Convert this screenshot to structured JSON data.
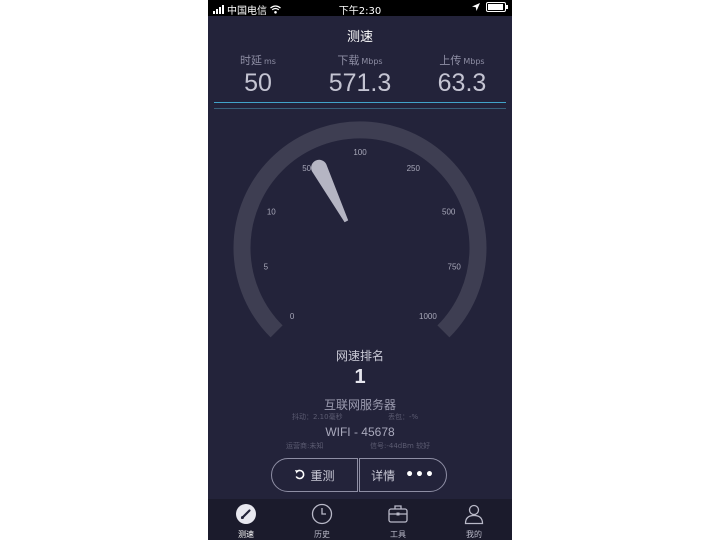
{
  "status_bar": {
    "carrier": "中国电信",
    "time": "下午2:30",
    "battery_level": 0.95
  },
  "header": {
    "title": "测速"
  },
  "stats": {
    "latency": {
      "label": "时延",
      "unit": "ms",
      "value": "50"
    },
    "download": {
      "label": "下载",
      "unit": "Mbps",
      "value": "571.3"
    },
    "upload": {
      "label": "上传",
      "unit": "Mbps",
      "value": "63.3"
    }
  },
  "gauge": {
    "ticks": [
      "0",
      "5",
      "10",
      "50",
      "100",
      "250",
      "500",
      "750",
      "1000"
    ],
    "needle_tick_fraction": 0.4,
    "track_color": "#3e3e52",
    "needle_color": "#cfcfdc"
  },
  "rank": {
    "label": "网速排名",
    "value": "1"
  },
  "server": {
    "name": "互联网服务器",
    "jitter": "抖动：2.10毫秒",
    "packet_loss": "丢包：-%",
    "network": "WIFI - 45678",
    "operator": "运营商:未知",
    "signal": "信号:-44dBm 较好"
  },
  "actions": {
    "retest": "重测",
    "detail": "详情",
    "more": "•••"
  },
  "tabs": [
    {
      "label": "测速",
      "icon": "speedometer-icon",
      "active": true
    },
    {
      "label": "历史",
      "icon": "clock-icon",
      "active": false
    },
    {
      "label": "工具",
      "icon": "toolbox-icon",
      "active": false
    },
    {
      "label": "我的",
      "icon": "user-icon",
      "active": false
    }
  ]
}
